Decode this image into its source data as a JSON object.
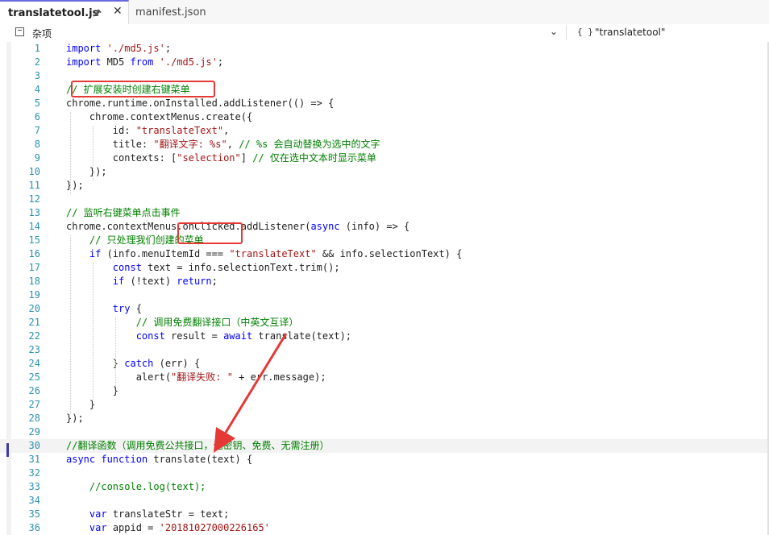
{
  "tabs": [
    {
      "label": "translatetool.js",
      "pin_icon": "pin-icon",
      "close_icon": "close-icon",
      "active": true
    },
    {
      "label": "manifest.json",
      "active": false
    }
  ],
  "navbar": {
    "left_label": "杂项",
    "right_icon": "{ }",
    "right_label": "\"translatetool\""
  },
  "colors": {
    "keyword": "#0000ff",
    "string": "#a31515",
    "comment": "#008000",
    "line_number": "#2b91af",
    "annotation": "#e53935",
    "tab_accent": "#6a6ae0"
  },
  "current_line": 30,
  "lines": [
    {
      "n": "1",
      "tokens": [
        {
          "t": "k",
          "v": "import"
        },
        {
          "t": "p",
          "v": " "
        },
        {
          "t": "s",
          "v": "'./md5.js'"
        },
        {
          "t": "p",
          "v": ";"
        }
      ]
    },
    {
      "n": "2",
      "tokens": [
        {
          "t": "k",
          "v": "import"
        },
        {
          "t": "p",
          "v": " MD5 "
        },
        {
          "t": "k",
          "v": "from"
        },
        {
          "t": "p",
          "v": " "
        },
        {
          "t": "s",
          "v": "'./md5.js'"
        },
        {
          "t": "p",
          "v": ";"
        }
      ]
    },
    {
      "n": "3",
      "tokens": []
    },
    {
      "n": "4",
      "tokens": [
        {
          "t": "c",
          "v": "// 扩展安装时创建右键菜单"
        }
      ]
    },
    {
      "n": "5",
      "tokens": [
        {
          "t": "p",
          "v": "chrome.runtime.onInstalled.addListener(() => {"
        }
      ]
    },
    {
      "n": "6",
      "tokens": [
        {
          "t": "p",
          "v": "    chrome.contextMenus.create({"
        }
      ]
    },
    {
      "n": "7",
      "tokens": [
        {
          "t": "p",
          "v": "        id: "
        },
        {
          "t": "s",
          "v": "\"translateText\""
        },
        {
          "t": "p",
          "v": ","
        }
      ]
    },
    {
      "n": "8",
      "tokens": [
        {
          "t": "p",
          "v": "        title: "
        },
        {
          "t": "s",
          "v": "\"翻译文字: %s\""
        },
        {
          "t": "p",
          "v": ", "
        },
        {
          "t": "c",
          "v": "// %s 会自动替换为选中的文字"
        }
      ]
    },
    {
      "n": "9",
      "tokens": [
        {
          "t": "p",
          "v": "        contexts: ["
        },
        {
          "t": "s",
          "v": "\"selection\""
        },
        {
          "t": "p",
          "v": "] "
        },
        {
          "t": "c",
          "v": "// 仅在选中文本时显示菜单"
        }
      ]
    },
    {
      "n": "10",
      "tokens": [
        {
          "t": "p",
          "v": "    });"
        }
      ]
    },
    {
      "n": "11",
      "tokens": [
        {
          "t": "p",
          "v": "});"
        }
      ]
    },
    {
      "n": "12",
      "tokens": []
    },
    {
      "n": "13",
      "tokens": [
        {
          "t": "c",
          "v": "// 监听右键菜单点击事件"
        }
      ]
    },
    {
      "n": "14",
      "tokens": [
        {
          "t": "p",
          "v": "chrome.contextMenus.onClicked.addListener("
        },
        {
          "t": "k",
          "v": "async"
        },
        {
          "t": "p",
          "v": " (info) => {"
        }
      ]
    },
    {
      "n": "15",
      "tokens": [
        {
          "t": "c",
          "v": "    // 只处理我们创建的菜单"
        }
      ]
    },
    {
      "n": "16",
      "tokens": [
        {
          "t": "p",
          "v": "    "
        },
        {
          "t": "k",
          "v": "if"
        },
        {
          "t": "p",
          "v": " (info.menuItemId === "
        },
        {
          "t": "s",
          "v": "\"translateText\""
        },
        {
          "t": "p",
          "v": " && info.selectionText) {"
        }
      ]
    },
    {
      "n": "17",
      "tokens": [
        {
          "t": "p",
          "v": "        "
        },
        {
          "t": "k",
          "v": "const"
        },
        {
          "t": "p",
          "v": " text = info.selectionText.trim();"
        }
      ]
    },
    {
      "n": "18",
      "tokens": [
        {
          "t": "p",
          "v": "        "
        },
        {
          "t": "k",
          "v": "if"
        },
        {
          "t": "p",
          "v": " (!text) "
        },
        {
          "t": "k",
          "v": "return"
        },
        {
          "t": "p",
          "v": ";"
        }
      ]
    },
    {
      "n": "19",
      "tokens": []
    },
    {
      "n": "20",
      "tokens": [
        {
          "t": "p",
          "v": "        "
        },
        {
          "t": "k",
          "v": "try"
        },
        {
          "t": "p",
          "v": " {"
        }
      ]
    },
    {
      "n": "21",
      "tokens": [
        {
          "t": "c",
          "v": "            // 调用免费翻译接口（中英文互译）"
        }
      ]
    },
    {
      "n": "22",
      "tokens": [
        {
          "t": "p",
          "v": "            "
        },
        {
          "t": "k",
          "v": "const"
        },
        {
          "t": "p",
          "v": " result = "
        },
        {
          "t": "k",
          "v": "await"
        },
        {
          "t": "p",
          "v": " translate(text);"
        }
      ]
    },
    {
      "n": "23",
      "tokens": []
    },
    {
      "n": "24",
      "tokens": [
        {
          "t": "p",
          "v": "        } "
        },
        {
          "t": "k",
          "v": "catch"
        },
        {
          "t": "p",
          "v": " (err) {"
        }
      ]
    },
    {
      "n": "25",
      "tokens": [
        {
          "t": "p",
          "v": "            alert("
        },
        {
          "t": "s",
          "v": "\"翻译失败: \""
        },
        {
          "t": "p",
          "v": " + err.message);"
        }
      ]
    },
    {
      "n": "26",
      "tokens": [
        {
          "t": "p",
          "v": "        }"
        }
      ]
    },
    {
      "n": "27",
      "tokens": [
        {
          "t": "p",
          "v": "    }"
        }
      ]
    },
    {
      "n": "28",
      "tokens": [
        {
          "t": "p",
          "v": "});"
        }
      ]
    },
    {
      "n": "29",
      "tokens": []
    },
    {
      "n": "30",
      "tokens": [
        {
          "t": "c",
          "v": "//翻译函数（调用免费公共接口，无密钥、免费、无需注册）"
        }
      ]
    },
    {
      "n": "31",
      "tokens": [
        {
          "t": "k",
          "v": "async"
        },
        {
          "t": "p",
          "v": " "
        },
        {
          "t": "k",
          "v": "function"
        },
        {
          "t": "p",
          "v": " translate(text) {"
        }
      ]
    },
    {
      "n": "32",
      "tokens": []
    },
    {
      "n": "33",
      "tokens": [
        {
          "t": "c",
          "v": "    //console.log(text);"
        }
      ]
    },
    {
      "n": "34",
      "tokens": []
    },
    {
      "n": "35",
      "tokens": [
        {
          "t": "p",
          "v": "    "
        },
        {
          "t": "k",
          "v": "var"
        },
        {
          "t": "p",
          "v": " translateStr = text;"
        }
      ]
    },
    {
      "n": "36",
      "tokens": [
        {
          "t": "p",
          "v": "    "
        },
        {
          "t": "k",
          "v": "var"
        },
        {
          "t": "p",
          "v": " appid = "
        },
        {
          "t": "s",
          "v": "'20181027000226165'"
        }
      ]
    }
  ]
}
